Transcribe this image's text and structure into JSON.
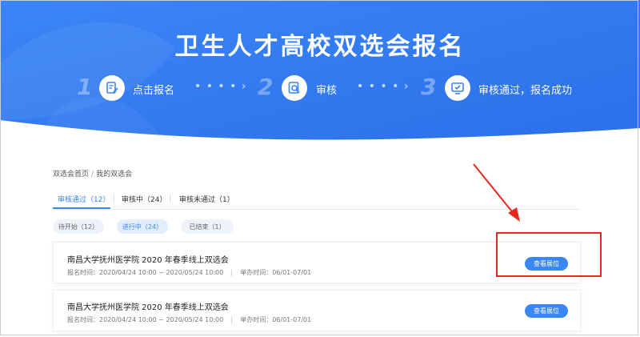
{
  "banner": {
    "title": "卫生人才高校双选会报名",
    "steps": [
      {
        "num": "1",
        "label": "点击报名",
        "icon": "edit-form-icon"
      },
      {
        "num": "2",
        "label": "审核",
        "icon": "search-document-icon"
      },
      {
        "num": "3",
        "label": "审核通过，报名成功",
        "icon": "monitor-check-icon"
      }
    ],
    "dots": "• • • • ›"
  },
  "breadcrumb": {
    "home": "双选会首页",
    "separator": "/",
    "current": "我的双选会"
  },
  "tabs": [
    {
      "label": "审核通过（12）",
      "active": true
    },
    {
      "label": "审核中（24）",
      "active": false
    },
    {
      "label": "审核未通过（1）",
      "active": false
    }
  ],
  "filters": [
    {
      "label": "待开始（12）",
      "active": false
    },
    {
      "label": "进行中（24）",
      "active": true
    },
    {
      "label": "已结束（1）",
      "active": false
    }
  ],
  "cards": [
    {
      "title": "南昌大学抚州医学院 2020 年春季线上双选会",
      "signup": "报名时间：2020/04/24 10:00 ~ 2020/05/24 10:00",
      "hold": "举办时间：06/01-07/01",
      "button": "查看展位"
    },
    {
      "title": "南昌大学抚州医学院 2020 年春季线上双选会",
      "signup": "报名时间：2020/04/24 10:00 ~ 2020/05/24 10:00",
      "hold": "举办时间：06/01-07/01",
      "button": "查看展位"
    }
  ],
  "colors": {
    "banner": "#2f78f0",
    "accent": "#3a86f4",
    "annotation": "#e8271d"
  }
}
